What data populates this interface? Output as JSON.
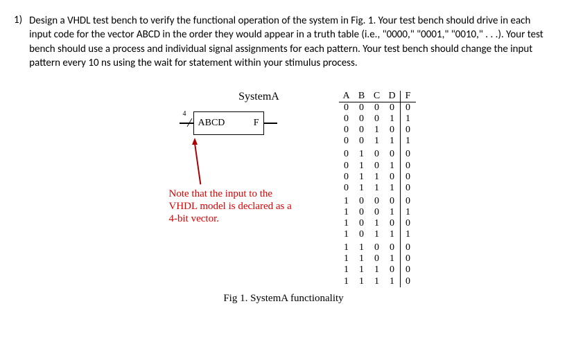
{
  "question": {
    "number": "1)",
    "text": "Design a VHDL test bench to verify the functional operation of the system in Fig. 1. Your test bench should drive in each input code for the vector ABCD in the order they would appear in a truth table (i.e., \"0000,\" \"0001,\" \"0010,\" . . .). Your test bench should use a process and individual signal assignments for each pattern. Your test bench should change the input pattern every 10 ns using the wait for statement within your stimulus process."
  },
  "system": {
    "title": "SystemA",
    "input_label": "ABCD",
    "output_label": "F",
    "bus_width": "4"
  },
  "note": "Note that the input to the VHDL model is declared as a 4-bit vector.",
  "truth_table": {
    "headers": [
      "A",
      "B",
      "C",
      "D",
      "F"
    ],
    "rows": [
      [
        "0",
        "0",
        "0",
        "0",
        "0"
      ],
      [
        "0",
        "0",
        "0",
        "1",
        "1"
      ],
      [
        "0",
        "0",
        "1",
        "0",
        "0"
      ],
      [
        "0",
        "0",
        "1",
        "1",
        "1"
      ],
      [
        "0",
        "1",
        "0",
        "0",
        "0"
      ],
      [
        "0",
        "1",
        "0",
        "1",
        "0"
      ],
      [
        "0",
        "1",
        "1",
        "0",
        "0"
      ],
      [
        "0",
        "1",
        "1",
        "1",
        "0"
      ],
      [
        "1",
        "0",
        "0",
        "0",
        "0"
      ],
      [
        "1",
        "0",
        "0",
        "1",
        "1"
      ],
      [
        "1",
        "0",
        "1",
        "0",
        "0"
      ],
      [
        "1",
        "0",
        "1",
        "1",
        "1"
      ],
      [
        "1",
        "1",
        "0",
        "0",
        "0"
      ],
      [
        "1",
        "1",
        "0",
        "1",
        "0"
      ],
      [
        "1",
        "1",
        "1",
        "0",
        "0"
      ],
      [
        "1",
        "1",
        "1",
        "1",
        "0"
      ]
    ]
  },
  "caption": "Fig 1. SystemA functionality"
}
